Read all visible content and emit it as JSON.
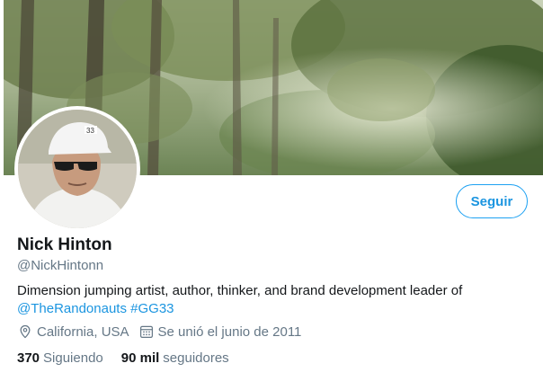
{
  "profile": {
    "name": "Nick Hinton",
    "handle": "@NickHintonn",
    "follow_label": "Seguir",
    "bio": {
      "text": "Dimension jumping artist, author, thinker, and brand development leader of",
      "mention": "@TheRandonauts",
      "hashtag": "#GG33"
    },
    "meta": {
      "location": "California, USA",
      "joined": "Se unió el junio de 2011",
      "location_icon": "map-pin-icon",
      "joined_icon": "calendar-icon"
    },
    "stats": {
      "following_count": "370",
      "following_label": "Siguiendo",
      "followers_count": "90 mil",
      "followers_label": "seguidores"
    }
  },
  "colors": {
    "accent": "#1b95e0",
    "secondary_text": "#657786",
    "primary_text": "#14171a"
  }
}
